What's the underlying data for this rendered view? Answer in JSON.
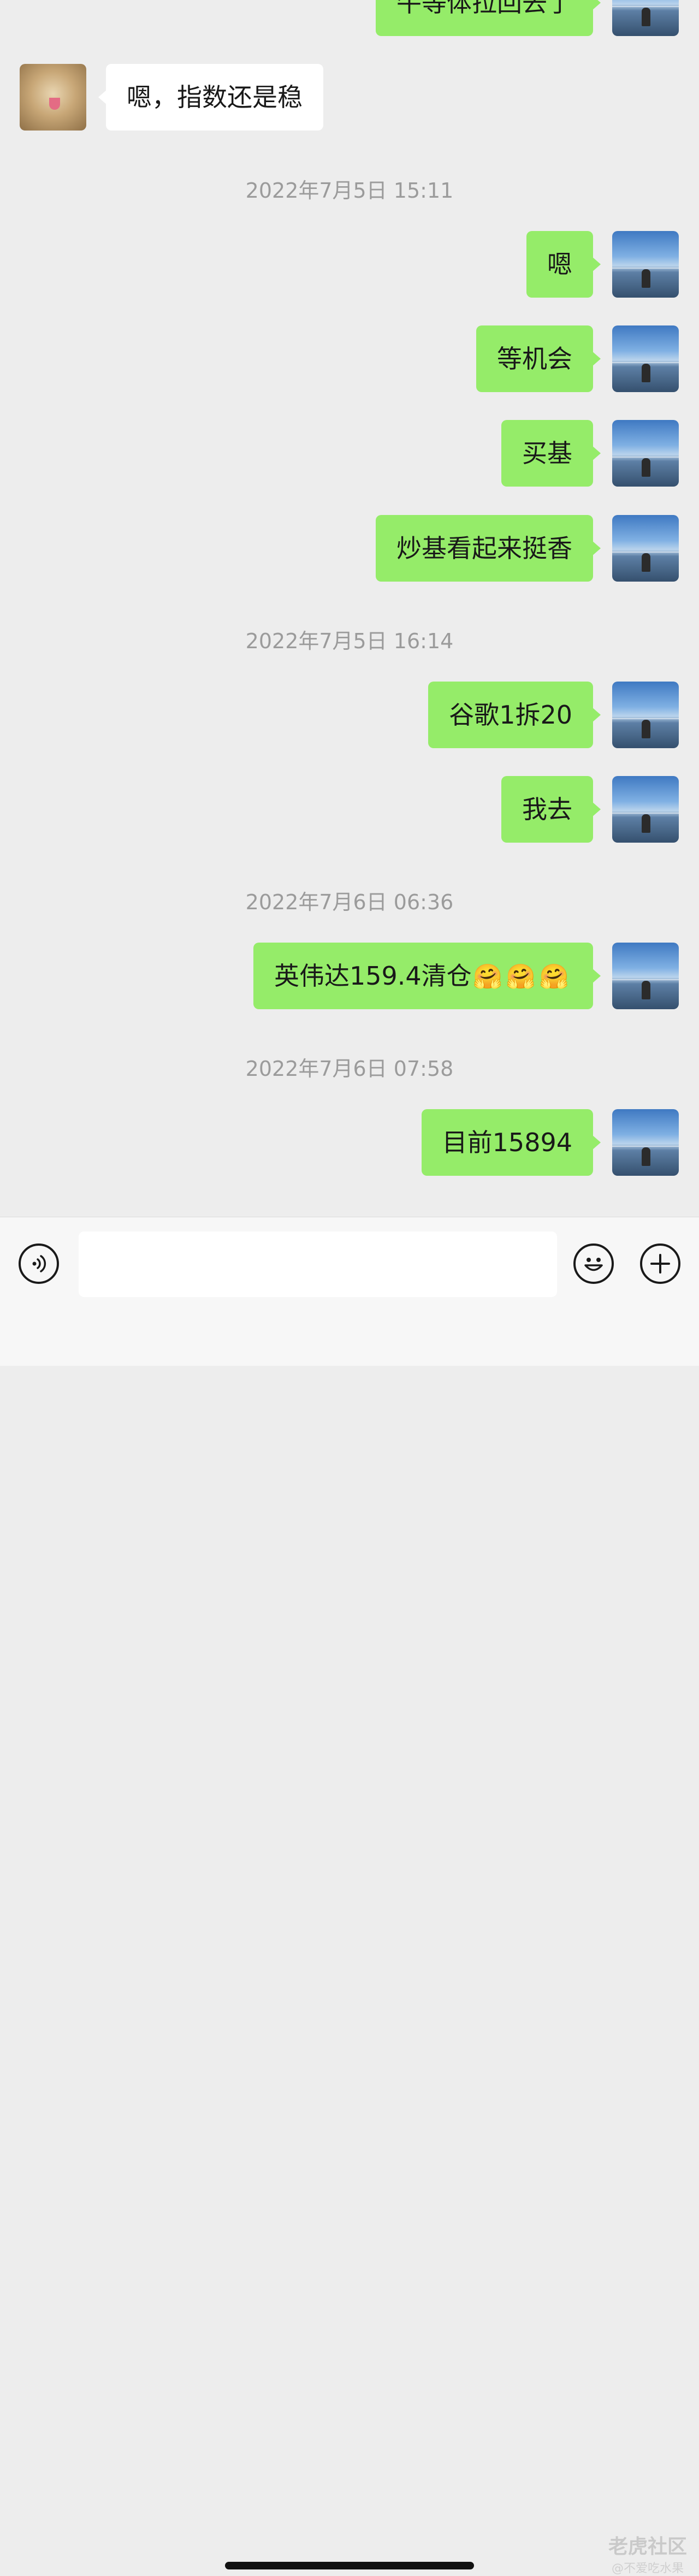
{
  "messages": {
    "partial_top": "牛等体拉回去了",
    "m1": "嗯，指数还是稳",
    "t1": "2022年7月5日 15:11",
    "m2": "嗯",
    "m3": "等机会",
    "m4": "买基",
    "m5": "炒基看起来挺香",
    "t2": "2022年7月5日 16:14",
    "m6": "谷歌1拆20",
    "m7": "我去",
    "t3": "2022年7月6日 06:36",
    "m8": "英伟达159.4清仓",
    "m8_emoji": "🤗🤗🤗",
    "t4": "2022年7月6日 07:58",
    "m9": "目前15894"
  },
  "input": {
    "value": ""
  },
  "icons": {
    "voice": "voice-icon",
    "emoji": "emoji-icon",
    "plus": "plus-icon"
  },
  "watermark": {
    "brand": "老虎社区",
    "user": "@不爱吃水果"
  },
  "colors": {
    "background": "#ededed",
    "sent_bubble": "#95ec69",
    "received_bubble": "#ffffff",
    "timestamp": "#9b9b9b"
  }
}
